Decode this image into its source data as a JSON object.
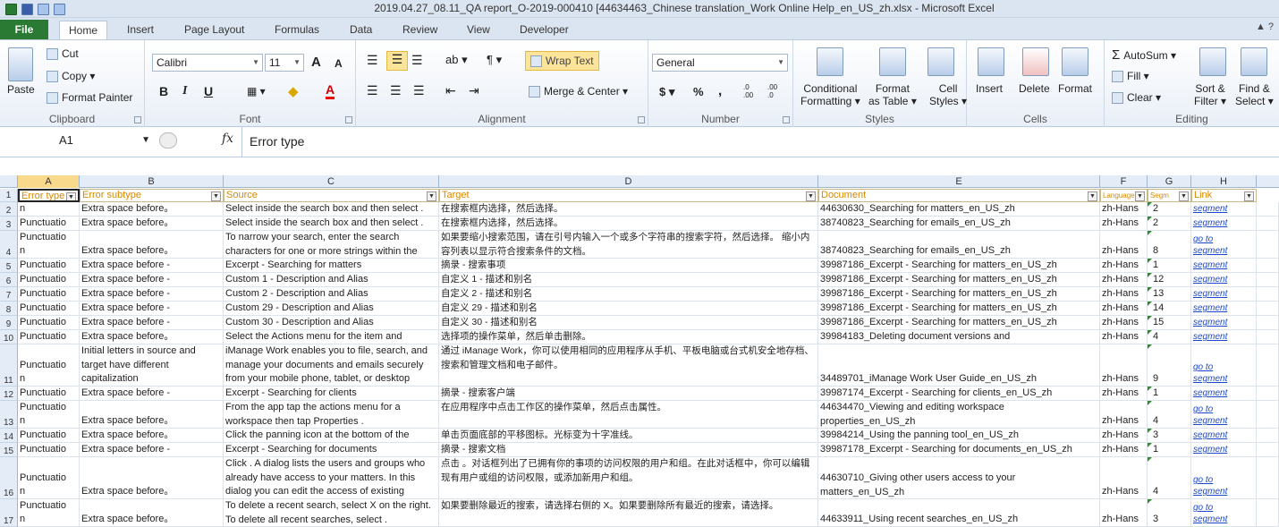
{
  "title": "2019.04.27_08.11_QA report_O-2019-000410 [44634463_Chinese translation_Work Online Help_en_US_zh.xlsx - Microsoft Excel",
  "tabs": {
    "file": "File",
    "home": "Home",
    "insert": "Insert",
    "layout": "Page Layout",
    "formulas": "Formulas",
    "data": "Data",
    "review": "Review",
    "view": "View",
    "developer": "Developer"
  },
  "clipboard": {
    "paste": "Paste",
    "cut": "Cut",
    "copy": "Copy",
    "format_painter": "Format Painter",
    "label": "Clipboard"
  },
  "font": {
    "name": "Calibri",
    "size": "11",
    "bold": "B",
    "italic": "I",
    "underline": "U",
    "grow": "A",
    "shrink": "A",
    "font_color": "A",
    "label": "Font"
  },
  "alignment": {
    "wrap": "Wrap Text",
    "merge": "Merge & Center",
    "label": "Alignment"
  },
  "number": {
    "format": "General",
    "currency": "$",
    "percent": "%",
    "comma": ",",
    "inc_dec": ".0\n.00",
    "dec_dec": ".00\n.0",
    "label": "Number"
  },
  "styles": {
    "cond": "Conditional",
    "cond2": "Formatting",
    "fmt_table": "Format",
    "fmt_table2": "as Table",
    "cell_styles": "Cell",
    "cell_styles2": "Styles",
    "label": "Styles"
  },
  "cells": {
    "insert": "Insert",
    "delete": "Delete",
    "format": "Format",
    "label": "Cells"
  },
  "editing": {
    "autosum": "AutoSum",
    "fill": "Fill",
    "clear": "Clear",
    "sort": "Sort &",
    "sort2": "Filter",
    "find": "Find &",
    "find2": "Select",
    "label": "Editing"
  },
  "formula_bar": {
    "name_box": "A1",
    "fx": "fx",
    "content": "Error type"
  },
  "columns": [
    "A",
    "B",
    "C",
    "D",
    "E",
    "F",
    "G",
    "H"
  ],
  "header_row": {
    "a": "Error type",
    "b": "Error subtype",
    "c": "Source",
    "d": "Target",
    "e": "Document",
    "f": "Language",
    "g": "Segm",
    "h": "Link"
  },
  "rows": [
    {
      "n": "2",
      "a": "n",
      "b": "Extra space before。",
      "c": "Select inside the search box and then select .",
      "d": "在搜索框内选择，然后选择。",
      "e": "44630630_Searching for matters_en_US_zh",
      "f": "zh-Hans",
      "g": "2",
      "h1": "",
      "h2": "segment"
    },
    {
      "n": "3",
      "a": "Punctuatio",
      "b": "Extra space before。",
      "c": "Select inside the search box and then select .",
      "d": "在搜索框内选择，然后选择。",
      "e": "38740823_Searching for emails_en_US_zh",
      "f": "zh-Hans",
      "g": "2",
      "h1": "",
      "h2": "segment"
    },
    {
      "n": "4",
      "a1": "Punctuatio",
      "a": "n",
      "b": "Extra space before。",
      "c": "To narrow your search, enter the search characters for one or more strings within the",
      "d": "如果要缩小搜索范围，请在引号内输入一个或多个字符串的搜索字符，然后选择。 缩小内容列表以显示符合搜索条件的文档。",
      "e": "38740823_Searching for emails_en_US_zh",
      "f": "zh-Hans",
      "g": "8",
      "h1": "go to",
      "h2": "segment"
    },
    {
      "n": "5",
      "a": "Punctuatio",
      "b": "Extra space before -",
      "c": "Excerpt - Searching for matters",
      "d": "摘录 - 搜索事项",
      "e": "39987186_Excerpt - Searching for matters_en_US_zh",
      "f": "zh-Hans",
      "g": "1",
      "h1": "",
      "h2": "segment"
    },
    {
      "n": "6",
      "a": "Punctuatio",
      "b": "Extra space before -",
      "c": "Custom 1 - Description and Alias",
      "d": "自定义 1 - 描述和别名",
      "e": "39987186_Excerpt - Searching for matters_en_US_zh",
      "f": "zh-Hans",
      "g": "12",
      "h1": "",
      "h2": "segment"
    },
    {
      "n": "7",
      "a": "Punctuatio",
      "b": "Extra space before -",
      "c": "Custom 2 - Description and Alias",
      "d": "自定义 2 - 描述和别名",
      "e": "39987186_Excerpt - Searching for matters_en_US_zh",
      "f": "zh-Hans",
      "g": "13",
      "h1": "",
      "h2": "segment"
    },
    {
      "n": "8",
      "a": "Punctuatio",
      "b": "Extra space before -",
      "c": "Custom 29 - Description and Alias",
      "d": "自定义 29 - 描述和别名",
      "e": "39987186_Excerpt - Searching for matters_en_US_zh",
      "f": "zh-Hans",
      "g": "14",
      "h1": "",
      "h2": "segment"
    },
    {
      "n": "9",
      "a": "Punctuatio",
      "b": "Extra space before -",
      "c": "Custom 30 - Description and Alias",
      "d": "自定义 30 - 描述和别名",
      "e": "39987186_Excerpt - Searching for matters_en_US_zh",
      "f": "zh-Hans",
      "g": "15",
      "h1": "",
      "h2": "segment"
    },
    {
      "n": "10",
      "a": "Punctuatio",
      "b": "Extra space before。",
      "c": "Select the Actions menu  for the item and",
      "d": "选择项的操作菜单，然后单击删除。",
      "e": "39984183_Deleting document versions and",
      "f": "zh-Hans",
      "g": "4",
      "h1": "",
      "h2": "segment"
    },
    {
      "n": "11",
      "a1": "Punctuatio",
      "a": "n",
      "b": "Initial letters in source and target have different capitalization",
      "c": "iManage Work enables you to file, search, and manage your documents and emails securely from your mobile phone, tablet, or desktop",
      "d": "通过 iManage Work，你可以使用相同的应用程序从手机、平板电脑或台式机安全地存档、搜索和管理文档和电子邮件。",
      "e": "34489701_iManage Work User Guide_en_US_zh",
      "f": "zh-Hans",
      "g": "9",
      "h1": "go to",
      "h2": "segment"
    },
    {
      "n": "12",
      "a": "Punctuatio",
      "b": "Extra space before -",
      "c": "Excerpt - Searching for clients",
      "d": "摘录 - 搜索客户端",
      "e": "39987174_Excerpt - Searching for clients_en_US_zh",
      "f": "zh-Hans",
      "g": "1",
      "h1": "",
      "h2": "segment"
    },
    {
      "n": "13",
      "a1": "Punctuatio",
      "a": "n",
      "b": "Extra space before。",
      "c": "From the app tap the actions menu  for a workspace then tap Properties .",
      "d": "在应用程序中点击工作区的操作菜单，然后点击属性。",
      "e": "44634470_Viewing and editing workspace properties_en_US_zh",
      "f": "zh-Hans",
      "g": "4",
      "h1": "go to",
      "h2": "segment"
    },
    {
      "n": "14",
      "a": "Punctuatio",
      "b": "Extra space before。",
      "c": "Click the panning icon  at the bottom of the",
      "d": "单击页面底部的平移图标。光标变为十字准线。",
      "e": "39984214_Using the panning tool_en_US_zh",
      "f": "zh-Hans",
      "g": "3",
      "h1": "",
      "h2": "segment"
    },
    {
      "n": "15",
      "a": "Punctuatio",
      "b": "Extra space before -",
      "c": "Excerpt - Searching for documents",
      "d": "摘录 - 搜索文档",
      "e": "39987178_Excerpt - Searching for documents_en_US_zh",
      "f": "zh-Hans",
      "g": "1",
      "h1": "",
      "h2": "segment"
    },
    {
      "n": "16",
      "a1": "Punctuatio",
      "a": "n",
      "b": "Extra space before。",
      "c": "Click . A dialog lists the users and groups who already have access to your matters. In this dialog you can edit the access of existing",
      "d": "点击 。对话框列出了已拥有你的事项的访问权限的用户和组。在此对话框中，你可以编辑现有用户或组的访问权限，或添加新用户和组。",
      "e": "44630710_Giving other users access to your matters_en_US_zh",
      "f": "zh-Hans",
      "g": "4",
      "h1": "go to",
      "h2": "segment"
    },
    {
      "n": "17",
      "a1": "Punctuatio",
      "a": "n",
      "b": "Extra space before。",
      "c": "To delete a recent search, select X on the right. To delete all recent searches, select .",
      "d": "如果要删除最近的搜索，请选择右侧的 X。如果要删除所有最近的搜索，请选择。",
      "e": "44633911_Using recent searches_en_US_zh",
      "f": "zh-Hans",
      "g": "3",
      "h1": "go to",
      "h2": "segment"
    }
  ]
}
